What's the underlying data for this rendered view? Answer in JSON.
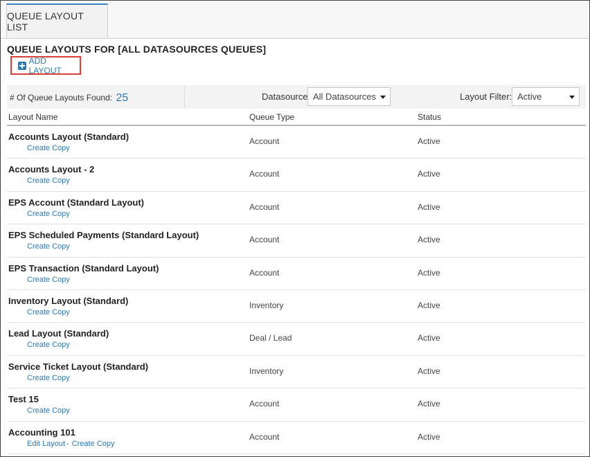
{
  "tab": {
    "label": "QUEUE LAYOUT LIST"
  },
  "title": "QUEUE LAYOUTS FOR [ALL DATASOURCES QUEUES]",
  "add_button": {
    "label": "ADD LAYOUT"
  },
  "filters": {
    "count_label": "# Of Queue Layouts Found:",
    "count_value": "25",
    "datasource_label": "Datasource:",
    "datasource_value": "All Datasources",
    "layout_filter_label": "Layout Filter:",
    "layout_filter_value": "Active"
  },
  "table": {
    "columns": [
      "Layout Name",
      "Queue Type",
      "Status"
    ],
    "rows": [
      {
        "name": "Accounts Layout (Standard)",
        "links": [
          "Create Copy"
        ],
        "type": "Account",
        "status": "Active"
      },
      {
        "name": "Accounts Layout - 2",
        "links": [
          "Create Copy"
        ],
        "type": "Account",
        "status": "Active"
      },
      {
        "name": "EPS Account (Standard Layout)",
        "links": [
          "Create Copy"
        ],
        "type": "Account",
        "status": "Active"
      },
      {
        "name": "EPS Scheduled Payments (Standard Layout)",
        "links": [
          "Create Copy"
        ],
        "type": "Account",
        "status": "Active"
      },
      {
        "name": "EPS Transaction (Standard Layout)",
        "links": [
          "Create Copy"
        ],
        "type": "Account",
        "status": "Active"
      },
      {
        "name": "Inventory Layout (Standard)",
        "links": [
          "Create Copy"
        ],
        "type": "Inventory",
        "status": "Active"
      },
      {
        "name": "Lead Layout (Standard)",
        "links": [
          "Create Copy"
        ],
        "type": "Deal / Lead",
        "status": "Active"
      },
      {
        "name": "Service Ticket Layout (Standard)",
        "links": [
          "Create Copy"
        ],
        "type": "Inventory",
        "status": "Active"
      },
      {
        "name": "Test 15",
        "links": [
          "Create Copy"
        ],
        "type": "Account",
        "status": "Active"
      },
      {
        "name": "Accounting 101",
        "links": [
          "Edit Layout",
          "Create Copy"
        ],
        "type": "Account",
        "status": "Active"
      }
    ]
  },
  "colors": {
    "accent": "#2a7ab8",
    "highlight_border": "#d9403a",
    "tab_top": "#3b7fc4"
  },
  "icons": {
    "add": "plus-square-icon",
    "dropdown": "caret-down-icon"
  }
}
